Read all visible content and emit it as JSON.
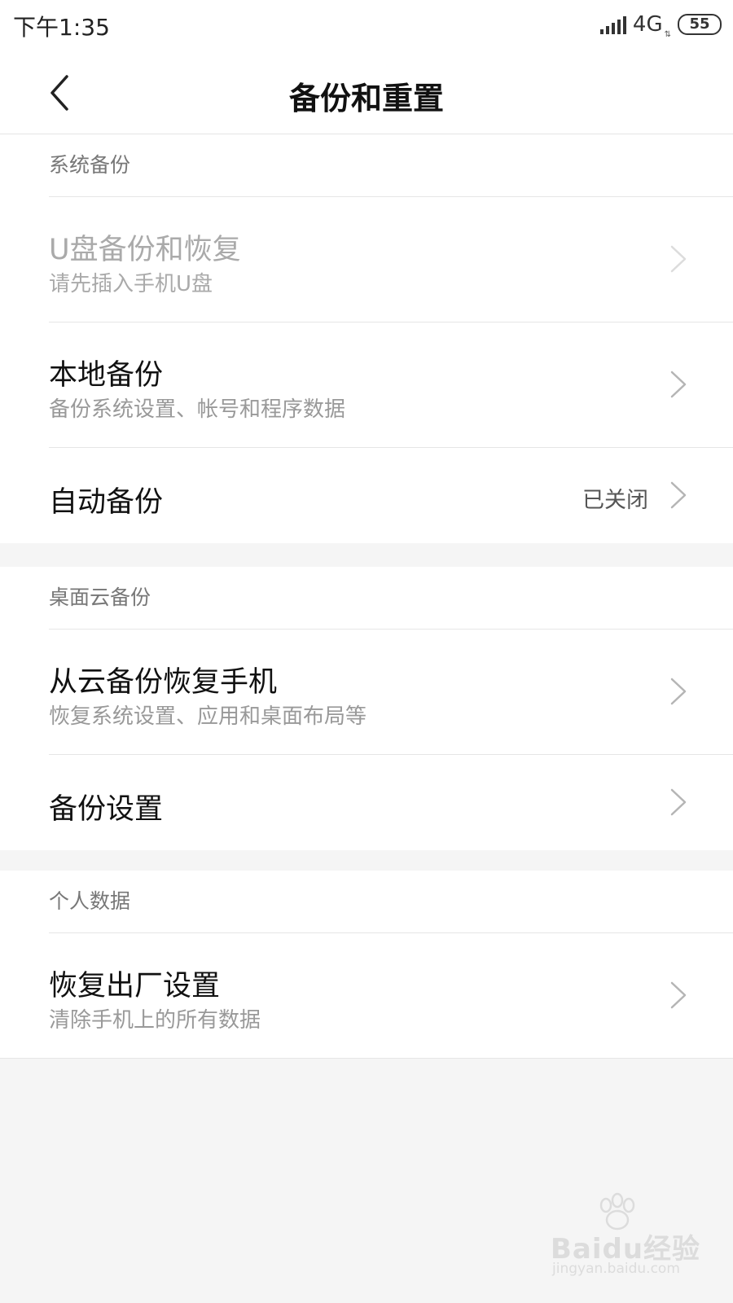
{
  "status_bar": {
    "time": "下午1:35",
    "network": "4G",
    "network_arrows": "⇅",
    "battery": "55"
  },
  "header": {
    "title": "备份和重置",
    "back_icon": "chevron-left-icon"
  },
  "sections": [
    {
      "header": "系统备份",
      "items": [
        {
          "title": "U盘备份和恢复",
          "subtitle": "请先插入手机U盘",
          "disabled": true
        },
        {
          "title": "本地备份",
          "subtitle": "备份系统设置、帐号和程序数据"
        },
        {
          "title": "自动备份",
          "value": "已关闭"
        }
      ]
    },
    {
      "header": "桌面云备份",
      "items": [
        {
          "title": "从云备份恢复手机",
          "subtitle": "恢复系统设置、应用和桌面布局等"
        },
        {
          "title": "备份设置"
        }
      ]
    },
    {
      "header": "个人数据",
      "items": [
        {
          "title": "恢复出厂设置",
          "subtitle": "清除手机上的所有数据"
        }
      ]
    }
  ],
  "watermark": {
    "text": "Baidu经验",
    "url": "jingyan.baidu.com"
  },
  "colors": {
    "background": "#f5f5f5",
    "card": "#ffffff",
    "title_text": "#111111",
    "subtitle_text": "#999999",
    "disabled_text": "#aaaaaa"
  }
}
